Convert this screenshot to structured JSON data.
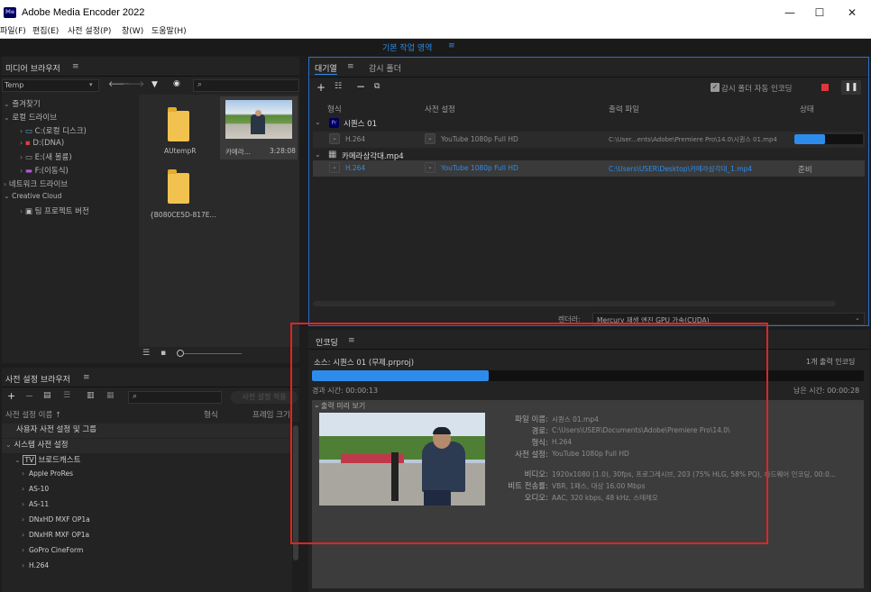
{
  "window": {
    "logo": "Me",
    "title": "Adobe Media Encoder 2022",
    "minimize": "—",
    "maximize": "☐",
    "close": "✕"
  },
  "menu": [
    "파일(F)",
    "편집(E)",
    "사전 설정(P)",
    "창(W)",
    "도움말(H)"
  ],
  "workspace": {
    "label": "기본 작업 영역",
    "icon": "menu-icon"
  },
  "media_browser": {
    "title": "미디어 브라우저",
    "location": "Temp",
    "tree": [
      {
        "label": "즐겨찾기",
        "level": 0
      },
      {
        "label": "로컬 드라이브",
        "level": 0
      },
      {
        "label": "C:(로컬 디스크)",
        "level": 1
      },
      {
        "label": "D:(DNA)",
        "level": 1
      },
      {
        "label": "E:(새 볼륨)",
        "level": 1
      },
      {
        "label": "F:(이동식)",
        "level": 1
      },
      {
        "label": "네트워크 드라이브",
        "level": 0
      },
      {
        "label": "Creative Cloud",
        "level": 0
      },
      {
        "label": "팀 프로젝트 버전",
        "level": 1
      }
    ],
    "items": [
      {
        "name": "AUtempR",
        "type": "folder"
      },
      {
        "name": "카메라...",
        "type": "video",
        "duration": "3:28:08"
      },
      {
        "name": "{B080CE5D-817E...",
        "type": "folder"
      }
    ]
  },
  "preset_browser": {
    "title": "사전 설정 브라우저",
    "search_placeholder": "",
    "apply_label": "사전 설정 적용",
    "columns": [
      "사전 설정 이름 ↑",
      "형식",
      "프레임 크기"
    ],
    "rows": [
      {
        "label": "사용자 사전 설정 및 그룹",
        "level": 0,
        "bold": true
      },
      {
        "label": "시스템 사전 설정",
        "level": 0,
        "bold": true
      },
      {
        "label": "브로드캐스트",
        "level": 1,
        "bold": true
      },
      {
        "label": "Apple ProRes",
        "level": 2
      },
      {
        "label": "AS-10",
        "level": 2
      },
      {
        "label": "AS-11",
        "level": 2
      },
      {
        "label": "DNxHD MXF OP1a",
        "level": 2
      },
      {
        "label": "DNxHR MXF OP1a",
        "level": 2
      },
      {
        "label": "GoPro CineForm",
        "level": 2
      },
      {
        "label": "H.264",
        "level": 2
      }
    ]
  },
  "queue": {
    "tabs": [
      "대기열",
      "감시 폴더"
    ],
    "auto_encode_label": "감시 폴더 자동 인코딩",
    "columns": [
      "형식",
      "사전 설정",
      "출력 파일",
      "상태"
    ],
    "groups": [
      {
        "source": "시퀀스 01",
        "format": "H.264",
        "preset": "YouTube 1080p Full HD",
        "output": "C:\\User...ents\\Adobe\\Premiere Pro\\14.0\\시퀀스 01.mp4",
        "status_progress": 0.45,
        "active": true
      },
      {
        "source": "카메라삼각대.mp4",
        "format": "H.264",
        "preset": "YouTube 1080p Full HD",
        "output": "C:\\Users\\USER\\Desktop\\카메라삼각대_1.mp4",
        "status": "준비",
        "active": false
      }
    ],
    "renderer_label": "렌더러:",
    "renderer_value": "Mercury 재생 엔진 GPU 가속(CUDA)"
  },
  "encoding": {
    "title": "인코딩",
    "source": "소스: 시퀀스 01 (무제.prproj)",
    "output_count": "1개 출력 인코딩",
    "progress": 0.32,
    "elapsed": "경과 시간: 00:00:13",
    "remaining": "남은 시간: 00:00:28",
    "preview_label": "출력 미리 보기",
    "info": [
      {
        "label": "파일 이름:",
        "value": "시퀀스 01.mp4"
      },
      {
        "label": "경로:",
        "value": "C:\\Users\\USER\\Documents\\Adobe\\Premiere Pro\\14.0\\"
      },
      {
        "label": "형식:",
        "value": "H.264"
      },
      {
        "label": "사전 설정:",
        "value": "YouTube 1080p Full HD"
      },
      {
        "label": "비디오:",
        "value": "1920x1080 (1.0), 30fps, 프로그레시브, 203 (75% HLG, 58% PQ), 하드웨어 인코딩, 00:0..."
      },
      {
        "label": "비트 전송률:",
        "value": "VBR, 1패스, 대상 16.00 Mbps"
      },
      {
        "label": "오디오:",
        "value": "AAC, 320 kbps, 48 kHz, 스테레오"
      }
    ]
  },
  "colors": {
    "accent": "#2d8ceb",
    "highlight_box": "#e02424",
    "stop_button": "#e0363c",
    "folder": "#f1c24f"
  }
}
